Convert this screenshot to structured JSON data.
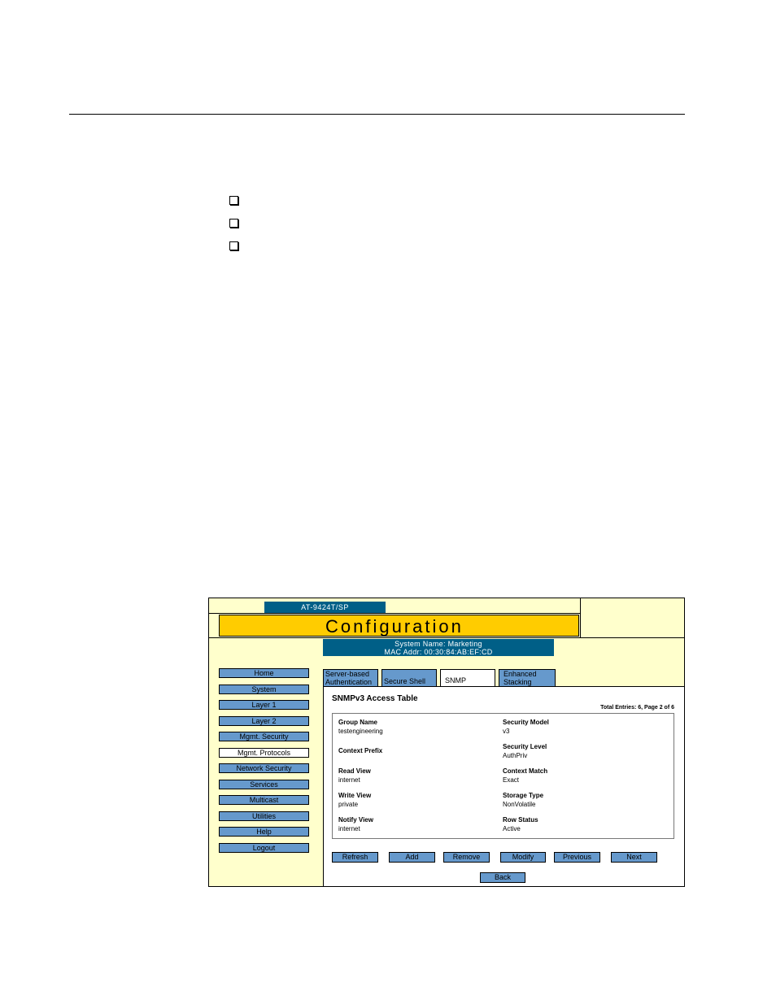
{
  "nav_items": [
    "Home",
    "System",
    "Layer 1",
    "Layer 2",
    "Mgmt. Security",
    "Mgmt. Protocols",
    "Network Security",
    "Services",
    "Multicast",
    "Utilities",
    "Help",
    "Logout"
  ],
  "ui": {
    "model": "AT-9424T/SP",
    "banner_title": "Configuration",
    "system_name": "System Name: Marketing",
    "mac_addr": "MAC Addr: 00:30:84:AB:EF:CD",
    "tabs": {
      "server_auth_line1": "Server-based",
      "server_auth_line2": "Authentication",
      "secure_shell": "Secure Shell",
      "snmp": "SNMP",
      "enhanced_line1": "Enhanced",
      "enhanced_line2": "Stacking"
    },
    "panel_title": "SNMPv3 Access Table",
    "total_entries": "Total Entries: 6, Page 2 of 6",
    "fields": {
      "group_name_label": "Group Name",
      "group_name_value": "testengineering",
      "context_prefix_label": "Context Prefix",
      "read_view_label": "Read View",
      "read_view_value": "internet",
      "write_view_label": "Write View",
      "write_view_value": "private",
      "notify_view_label": "Notify View",
      "notify_view_value": "internet",
      "security_model_label": "Security Model",
      "security_model_value": "v3",
      "security_level_label": "Security Level",
      "security_level_value": "AuthPriv",
      "context_match_label": "Context Match",
      "context_match_value": "Exact",
      "storage_type_label": "Storage Type",
      "storage_type_value": "NonVolatile",
      "row_status_label": "Row Status",
      "row_status_value": "Active"
    },
    "buttons": {
      "refresh": "Refresh",
      "add": "Add",
      "remove": "Remove",
      "modify": "Modify",
      "previous": "Previous",
      "next": "Next",
      "back": "Back"
    }
  }
}
